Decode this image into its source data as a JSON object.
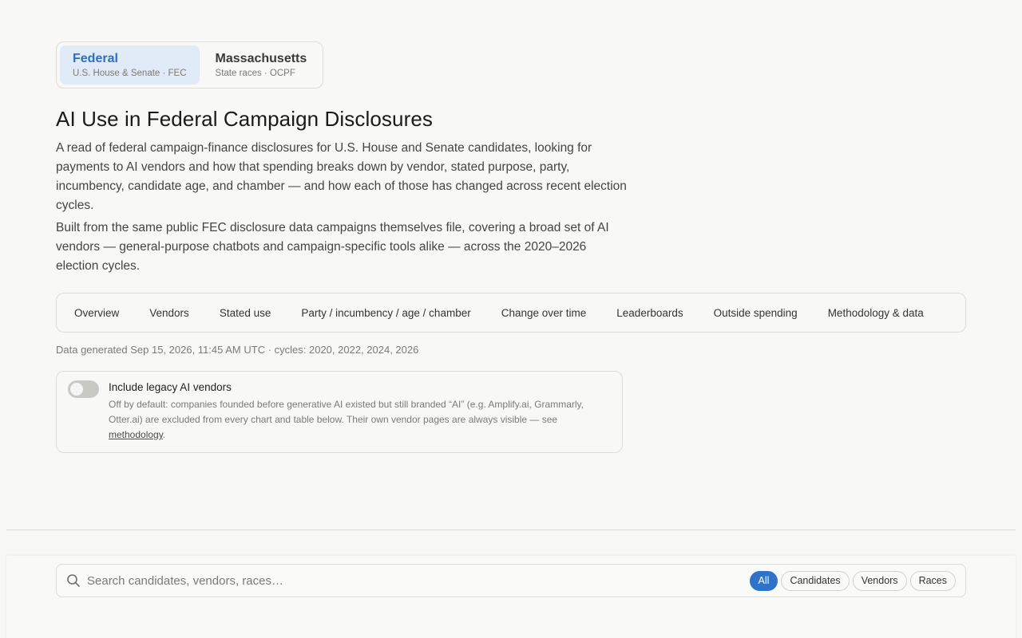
{
  "jurisdictions": [
    {
      "title": "Federal",
      "sub": "U.S. House & Senate · FEC",
      "active": true
    },
    {
      "title": "Massachusetts",
      "sub": "State races · OCPF",
      "active": false
    }
  ],
  "page_title": "AI Use in Federal Campaign Disclosures",
  "intro": [
    "A read of federal campaign-finance disclosures for U.S. House and Senate candidates, looking for payments to AI vendors and how that spending breaks down by vendor, stated purpose, party, incumbency, candidate age, and chamber — and how each of those has changed across recent election cycles.",
    "Built from the same public FEC disclosure data campaigns themselves file, covering a broad set of AI vendors — general-purpose chatbots and campaign-specific tools alike — across the 2020–2026 election cycles."
  ],
  "tabs": [
    "Overview",
    "Vendors",
    "Stated use",
    "Party / incumbency / age / chamber",
    "Change over time",
    "Leaderboards",
    "Outside spending",
    "Methodology & data"
  ],
  "meta": "Data generated Sep 15, 2026, 11:45 AM UTC · cycles: 2020, 2022, 2024, 2026",
  "legacy_toggle": {
    "label": "Include legacy AI vendors",
    "enabled": false,
    "desc_before": "Off by default: companies founded before generative AI existed but still branded “AI” (e.g. Amplify.ai, Grammarly, Otter.ai) are excluded from every chart and table below. Their own vendor pages are always visible — see ",
    "link": "methodology",
    "desc_after": "."
  },
  "search": {
    "placeholder": "Search candidates, vendors, races…",
    "filters": [
      "All",
      "Candidates",
      "Vendors",
      "Races"
    ],
    "active_filter": "All"
  },
  "colors": {
    "accent": "#2f72c9",
    "active_tab_bg": "#e1ebf7",
    "background": "#f8f8f6"
  }
}
